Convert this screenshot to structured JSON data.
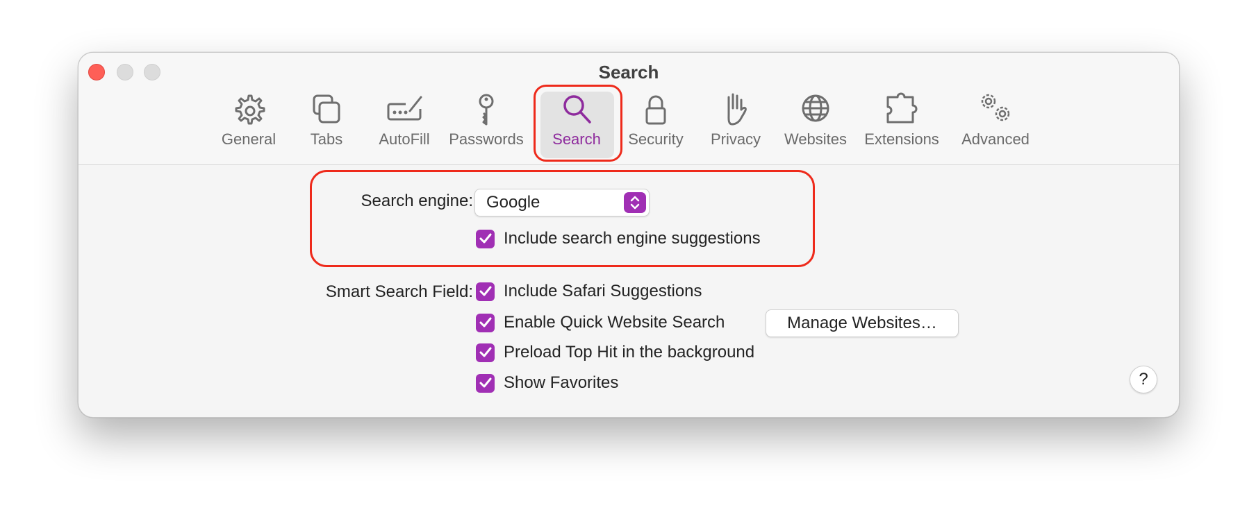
{
  "window": {
    "title": "Search"
  },
  "toolbar": {
    "tabs": [
      {
        "label": "General",
        "icon": "gear-icon"
      },
      {
        "label": "Tabs",
        "icon": "tabs-icon"
      },
      {
        "label": "AutoFill",
        "icon": "autofill-icon"
      },
      {
        "label": "Passwords",
        "icon": "key-icon"
      },
      {
        "label": "Search",
        "icon": "magnifier-icon",
        "selected": true
      },
      {
        "label": "Security",
        "icon": "lock-icon"
      },
      {
        "label": "Privacy",
        "icon": "hand-icon"
      },
      {
        "label": "Websites",
        "icon": "globe-icon"
      },
      {
        "label": "Extensions",
        "icon": "puzzle-icon"
      },
      {
        "label": "Advanced",
        "icon": "gears-icon"
      }
    ]
  },
  "search_engine": {
    "label": "Search engine:",
    "value": "Google",
    "suggestions_label": "Include search engine suggestions",
    "suggestions_checked": true
  },
  "smart_search": {
    "label": "Smart Search Field:",
    "options": [
      {
        "label": "Include Safari Suggestions",
        "checked": true
      },
      {
        "label": "Enable Quick Website Search",
        "checked": true
      },
      {
        "label": "Preload Top Hit in the background",
        "checked": true
      },
      {
        "label": "Show Favorites",
        "checked": true
      }
    ],
    "manage_button": "Manage Websites…"
  },
  "help_button": "?",
  "colors": {
    "accent": "#a02fb4",
    "selected_tab_text": "#8e2b9d",
    "annotation_red": "#ee2a1b"
  }
}
